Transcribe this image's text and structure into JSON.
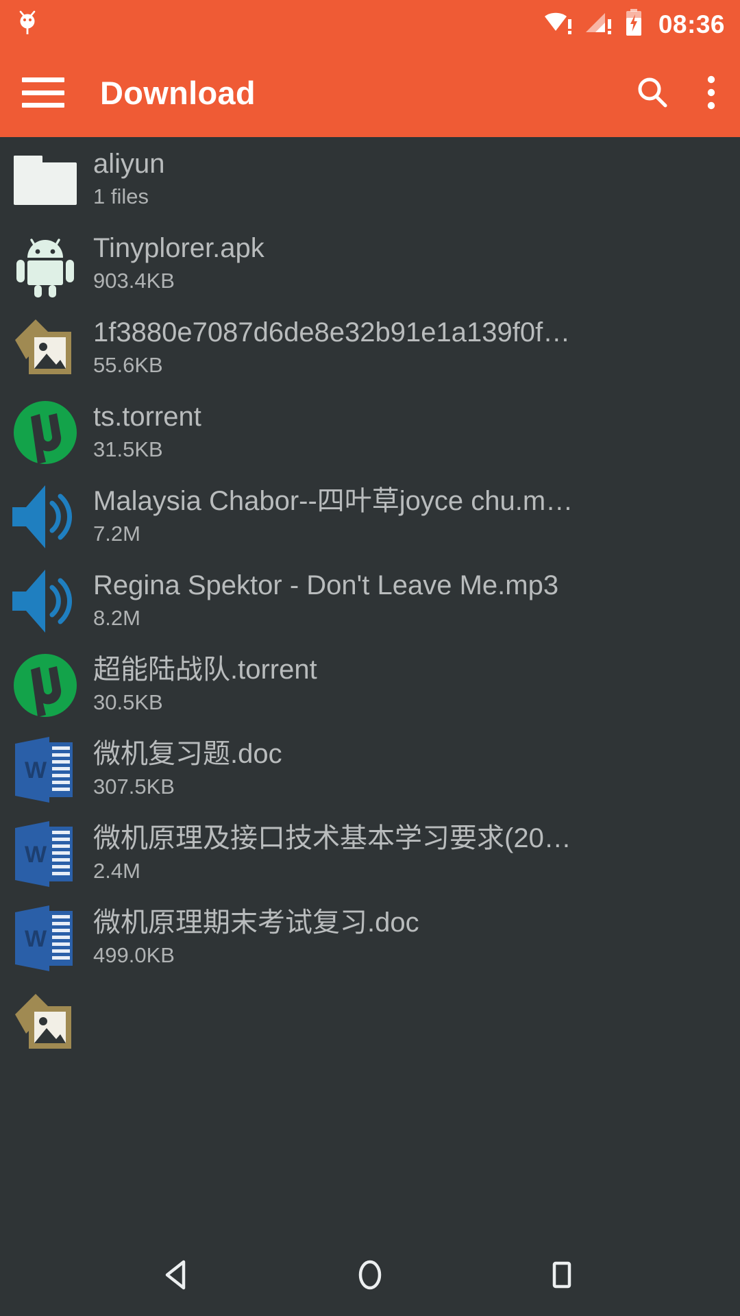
{
  "status_bar": {
    "notification_icon": "android-bug-icon",
    "wifi_icon": "wifi-warning-icon",
    "signal_icon": "cell-signal-warning-icon",
    "battery_icon": "battery-charging-icon",
    "clock": "08:36"
  },
  "toolbar": {
    "menu_icon": "hamburger-menu-icon",
    "title": "Download",
    "search_icon": "search-icon",
    "overflow_icon": "more-vertical-icon",
    "background_color": "#ef5b35"
  },
  "files": [
    {
      "name": "aliyun",
      "size": "1 files",
      "type": "folder"
    },
    {
      "name": "Tinyplorer.apk",
      "size": "903.4KB",
      "type": "apk"
    },
    {
      "name": "1f3880e7087d6de8e32b91e1a139f0f…",
      "size": "55.6KB",
      "type": "image"
    },
    {
      "name": "ts.torrent",
      "size": "31.5KB",
      "type": "torrent"
    },
    {
      "name": "Malaysia Chabor--四叶草joyce chu.m…",
      "size": "7.2M",
      "type": "audio"
    },
    {
      "name": "Regina Spektor - Don't Leave Me.mp3",
      "size": "8.2M",
      "type": "audio"
    },
    {
      "name": "超能陆战队.torrent",
      "size": "30.5KB",
      "type": "torrent"
    },
    {
      "name": "微机复习题.doc",
      "size": "307.5KB",
      "type": "doc"
    },
    {
      "name": "微机原理及接口技术基本学习要求(20…",
      "size": "2.4M",
      "type": "doc"
    },
    {
      "name": "微机原理期末考试复习.doc",
      "size": "499.0KB",
      "type": "doc"
    }
  ],
  "nav_bar": {
    "back_icon": "back-triangle-icon",
    "home_icon": "home-circle-icon",
    "recents_icon": "recents-square-icon"
  },
  "colors": {
    "accent": "#ef5b35",
    "background": "#2f3436",
    "text_primary": "#b9bcbd",
    "text_secondary": "#b0b3b4",
    "torrent_green": "#13a34a",
    "audio_blue": "#1f7fc0",
    "doc_blue": "#2a5fa8",
    "image_tan": "#a08a52"
  }
}
